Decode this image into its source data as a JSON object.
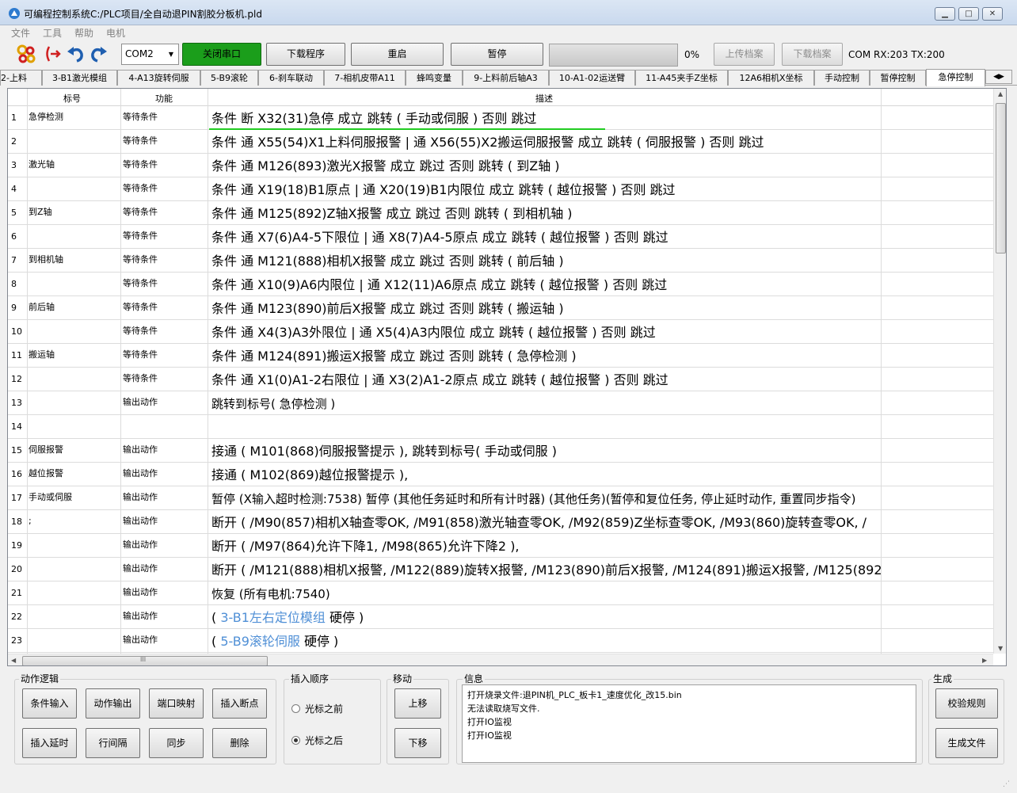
{
  "window": {
    "title": "可编程控制系统C:/PLC项目/全自动退PIN割胶分板机.pld",
    "min_label": "▁",
    "max_label": "□",
    "close_label": "✕"
  },
  "menu": [
    "文件",
    "工具",
    "帮助",
    "电机"
  ],
  "toolbar": {
    "com_port": "COM2",
    "close_port": "关闭串口",
    "download": "下载程序",
    "restart": "重启",
    "pause": "暂停",
    "progress_pct": 0,
    "progress_text": "0%",
    "upload_archive": "上传档案",
    "download_archive": "下载档案",
    "com_status": "COM RX:203 TX:200"
  },
  "tabs": [
    "2-上料",
    "3-B1激光模组",
    "4-A13旋转伺服",
    "5-B9滚轮",
    "6-刹车联动",
    "7-相机皮带A11",
    "蜂鸣变量",
    "9-上料前后轴A3",
    "10-A1-02运送臂",
    "11-A45夹手Z坐标",
    "12A6相机X坐标",
    "手动控制",
    "暂停控制",
    "急停控制"
  ],
  "active_tab": "急停控制",
  "grid": {
    "headers": [
      "标号",
      "功能",
      "描述"
    ],
    "rows": [
      {
        "n": "1",
        "label": "急停检测",
        "func": "等待条件",
        "desc": "条件 断 X32(31)急停 成立 跳转 ( 手动或伺服 ) 否则 跳过"
      },
      {
        "n": "2",
        "label": "",
        "func": "等待条件",
        "desc": "条件 通 X55(54)X1上料伺服报警 | 通 X56(55)X2搬运伺服报警 成立 跳转 ( 伺服报警 ) 否则 跳过"
      },
      {
        "n": "3",
        "label": "激光轴",
        "func": "等待条件",
        "desc": "条件 通 M126(893)激光X报警 成立 跳过 否则 跳转 ( 到Z轴 )"
      },
      {
        "n": "4",
        "label": "",
        "func": "等待条件",
        "desc": "条件 通 X19(18)B1原点 | 通 X20(19)B1内限位 成立 跳转 ( 越位报警 ) 否则 跳过"
      },
      {
        "n": "5",
        "label": "到Z轴",
        "func": "等待条件",
        "desc": "条件 通 M125(892)Z轴X报警 成立 跳过 否则 跳转 ( 到相机轴 )"
      },
      {
        "n": "6",
        "label": "",
        "func": "等待条件",
        "desc": "条件 通 X7(6)A4-5下限位 | 通 X8(7)A4-5原点 成立 跳转 ( 越位报警 ) 否则 跳过"
      },
      {
        "n": "7",
        "label": "到相机轴",
        "func": "等待条件",
        "desc": "条件 通 M121(888)相机X报警 成立 跳过 否则 跳转 ( 前后轴 )"
      },
      {
        "n": "8",
        "label": "",
        "func": "等待条件",
        "desc": "条件 通 X10(9)A6内限位 | 通 X12(11)A6原点 成立 跳转 ( 越位报警 ) 否则 跳过"
      },
      {
        "n": "9",
        "label": "前后轴",
        "func": "等待条件",
        "desc": "条件 通 M123(890)前后X报警 成立 跳过 否则 跳转 ( 搬运轴 )"
      },
      {
        "n": "10",
        "label": "",
        "func": "等待条件",
        "desc": "条件 通 X4(3)A3外限位 | 通 X5(4)A3内限位 成立 跳转 ( 越位报警 ) 否则 跳过"
      },
      {
        "n": "11",
        "label": "搬运轴",
        "func": "等待条件",
        "desc": "条件 通 M124(891)搬运X报警 成立 跳过 否则 跳转 ( 急停检测 )"
      },
      {
        "n": "12",
        "label": "",
        "func": "等待条件",
        "desc": "条件 通 X1(0)A1-2右限位 | 通 X3(2)A1-2原点 成立 跳转 ( 越位报警 ) 否则 跳过"
      },
      {
        "n": "13",
        "label": "",
        "func": "输出动作",
        "desc": "跳转到标号( 急停检测 )"
      },
      {
        "n": "14",
        "label": "",
        "func": "",
        "desc": ""
      },
      {
        "n": "15",
        "label": "伺服报警",
        "func": "输出动作",
        "desc": "接通 ( M101(868)伺服报警提示 ), 跳转到标号( 手动或伺服 )"
      },
      {
        "n": "16",
        "label": "越位报警",
        "func": "输出动作",
        "desc": "接通 ( M102(869)越位报警提示 ),"
      },
      {
        "n": "17",
        "label": "手动或伺服",
        "func": "输出动作",
        "desc": "暂停 (X输入超时检测:7538) 暂停 (其他任务延时和所有计时器) (其他任务)(暂停和复位任务, 停止延时动作, 重置同步指令)"
      },
      {
        "n": "18",
        "label": ";",
        "func": "输出动作",
        "desc": "断开 ( /M90(857)相机X轴查零OK, /M91(858)激光轴查零OK, /M92(859)Z坐标查零OK, /M93(860)旋转查零OK, /"
      },
      {
        "n": "19",
        "label": "",
        "func": "输出动作",
        "desc": "断开 ( /M97(864)允许下降1, /M98(865)允许下降2 ),"
      },
      {
        "n": "20",
        "label": "",
        "func": "输出动作",
        "desc": "断开 ( /M121(888)相机X报警, /M122(889)旋转X报警, /M123(890)前后X报警, /M124(891)搬运X报警, /M125(892"
      },
      {
        "n": "21",
        "label": "",
        "func": "输出动作",
        "desc": "恢复 (所有电机:7540)"
      },
      {
        "n": "22",
        "label": "",
        "func": "输出动作",
        "desc_pre": "( ",
        "desc_link": "3-B1左右定位模组",
        "desc_post": " 硬停 )"
      },
      {
        "n": "23",
        "label": "",
        "func": "输出动作",
        "desc_pre": "( ",
        "desc_link": "5-B9滚轮伺服",
        "desc_post": " 硬停 )"
      }
    ]
  },
  "scroll_grip": "III",
  "action_logic": {
    "title": "动作逻辑",
    "buttons": [
      "条件输入",
      "动作输出",
      "端口映射",
      "插入断点",
      "插入延时",
      "行间隔",
      "同步",
      "删除"
    ]
  },
  "insert_order": {
    "title": "插入顺序",
    "options": [
      "光标之前",
      "光标之后"
    ],
    "selected": "光标之后"
  },
  "move": {
    "title": "移动",
    "up": "上移",
    "down": "下移"
  },
  "info": {
    "title": "信息",
    "lines": [
      "打开烧录文件:退PIN机_PLC_板卡1_速度优化_改15.bin",
      "无法读取烧写文件.",
      "打开IO监视",
      "打开IO监视"
    ]
  },
  "generate": {
    "title": "生成",
    "check": "校验规则",
    "gen_file": "生成文件"
  },
  "colors": {
    "link": "#4f8fd6",
    "green_button": "#1b9e1b",
    "cursor_underline": "#22cc22"
  }
}
